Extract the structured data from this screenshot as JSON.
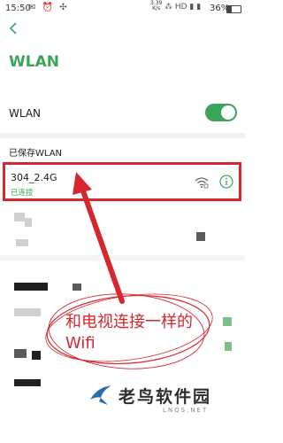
{
  "status_bar": {
    "time": "15:50",
    "left_icons": "✉ ⏰ ✣",
    "net_speed_value": "3.39",
    "net_speed_unit": "K/s",
    "right_icons": "⁂ HD ▮ ▮",
    "battery": "36%",
    "battery_level": 0.36
  },
  "header": {
    "title": "WLAN"
  },
  "wlan_toggle": {
    "label": "WLAN",
    "enabled": true
  },
  "saved_section": {
    "title": "已保存WLAN"
  },
  "saved_networks": [
    {
      "name": "304_2.4G",
      "status": "已连接"
    }
  ],
  "annotation": {
    "text": "和电视连接一样的Wifi",
    "color": "#d8262e"
  },
  "watermark": {
    "text": "老鸟软件园",
    "subtext": "LNQS.NET"
  },
  "colors": {
    "accent": "#3aa55a",
    "highlight": "#d8262e"
  }
}
